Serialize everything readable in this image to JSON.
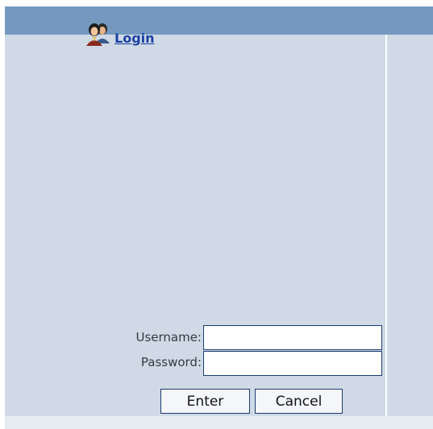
{
  "header": {
    "login_link": "Login"
  },
  "form": {
    "username_label": "Username:",
    "password_label": "Password:",
    "username_value": "",
    "password_value": ""
  },
  "buttons": {
    "enter_label": "Enter",
    "cancel_label": "Cancel"
  },
  "icons": {
    "login": "users-icon"
  },
  "colors": {
    "header_bar": "#7498c0",
    "panel_bg": "#cfdae6",
    "link": "#1a3fa3",
    "input_border": "#1b3a6e"
  }
}
